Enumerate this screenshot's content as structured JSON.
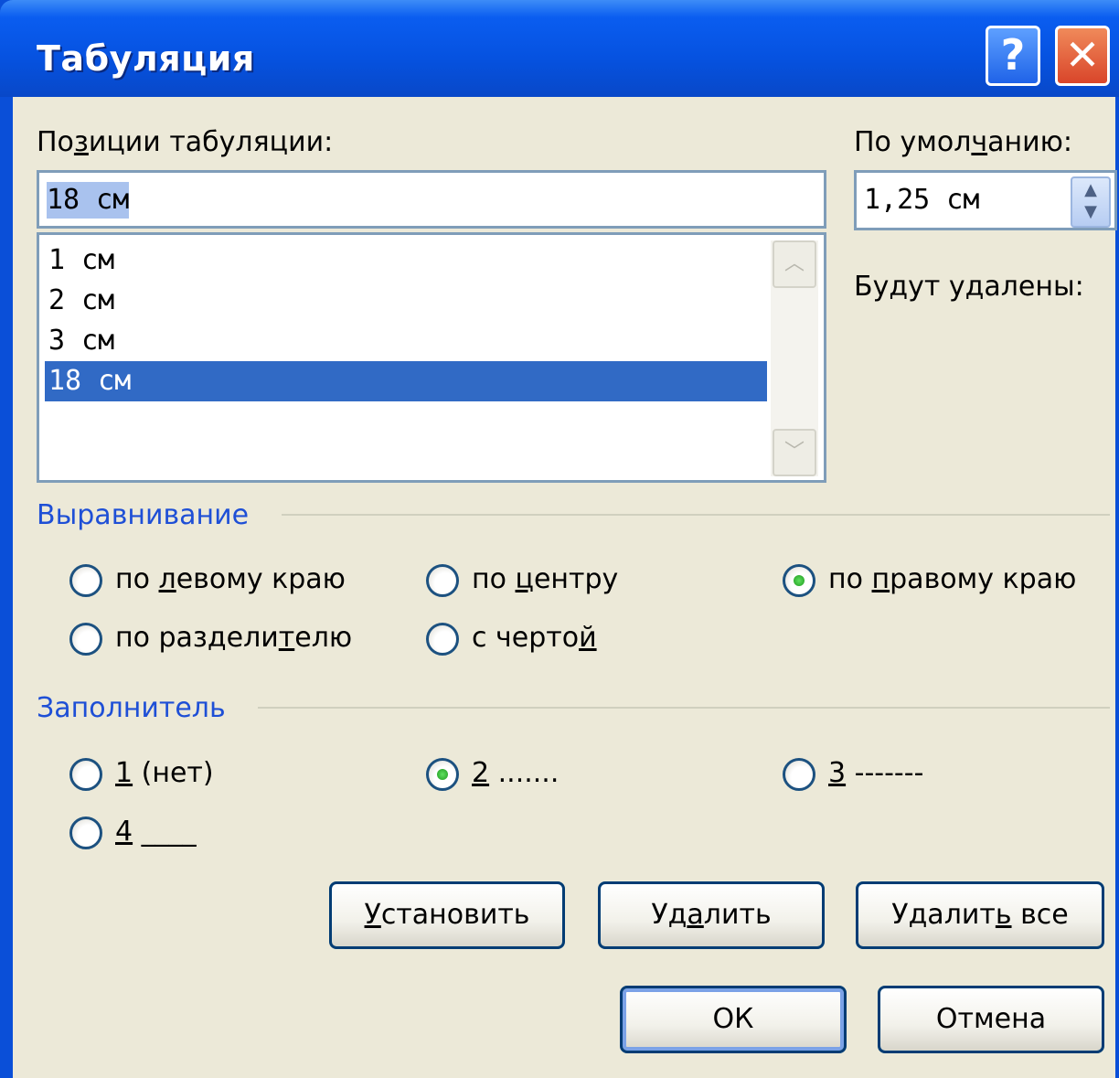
{
  "window": {
    "title": "Табуляция",
    "help_glyph": "?",
    "close_glyph": "✕"
  },
  "tab_positions": {
    "label_before": "По",
    "label_ul": "з",
    "label_after": "иции табуляции:",
    "value": "18 см",
    "items": [
      "1 см",
      "2 см",
      "3 см",
      "18 см"
    ],
    "selected_index": 3
  },
  "default": {
    "label_before": "По умол",
    "label_ul": "ч",
    "label_after": "анию:",
    "value": "1,25 см"
  },
  "to_clear_label": "Будут удалены:",
  "alignment": {
    "title": "Выравнивание",
    "left": {
      "before": "по ",
      "ul": "л",
      "after": "евому краю"
    },
    "center": {
      "before": "по ",
      "ul": "ц",
      "after": "ентру"
    },
    "right": {
      "before": "по ",
      "ul": "п",
      "after": "равому краю"
    },
    "decimal": {
      "before": "по раздели",
      "ul": "т",
      "after": "елю"
    },
    "bar": {
      "before": "с черто",
      "ul": "й",
      "after": ""
    },
    "selected": "right"
  },
  "leader": {
    "title": "Заполнитель",
    "opt1": {
      "ul": "1",
      "after": " (нет)"
    },
    "opt2": {
      "ul": "2",
      "after": " ......."
    },
    "opt3": {
      "ul": "3",
      "after": " -------"
    },
    "opt4": {
      "ul": "4",
      "after": " ____"
    },
    "selected": "2"
  },
  "buttons": {
    "set": {
      "ul": "У",
      "after": "становить"
    },
    "clear": {
      "before": "Уд",
      "ul": "а",
      "after": "лить"
    },
    "clear_all": {
      "before": "Удалит",
      "ul": "ь",
      "after": " все"
    },
    "ok": "ОК",
    "cancel": "Отмена"
  }
}
